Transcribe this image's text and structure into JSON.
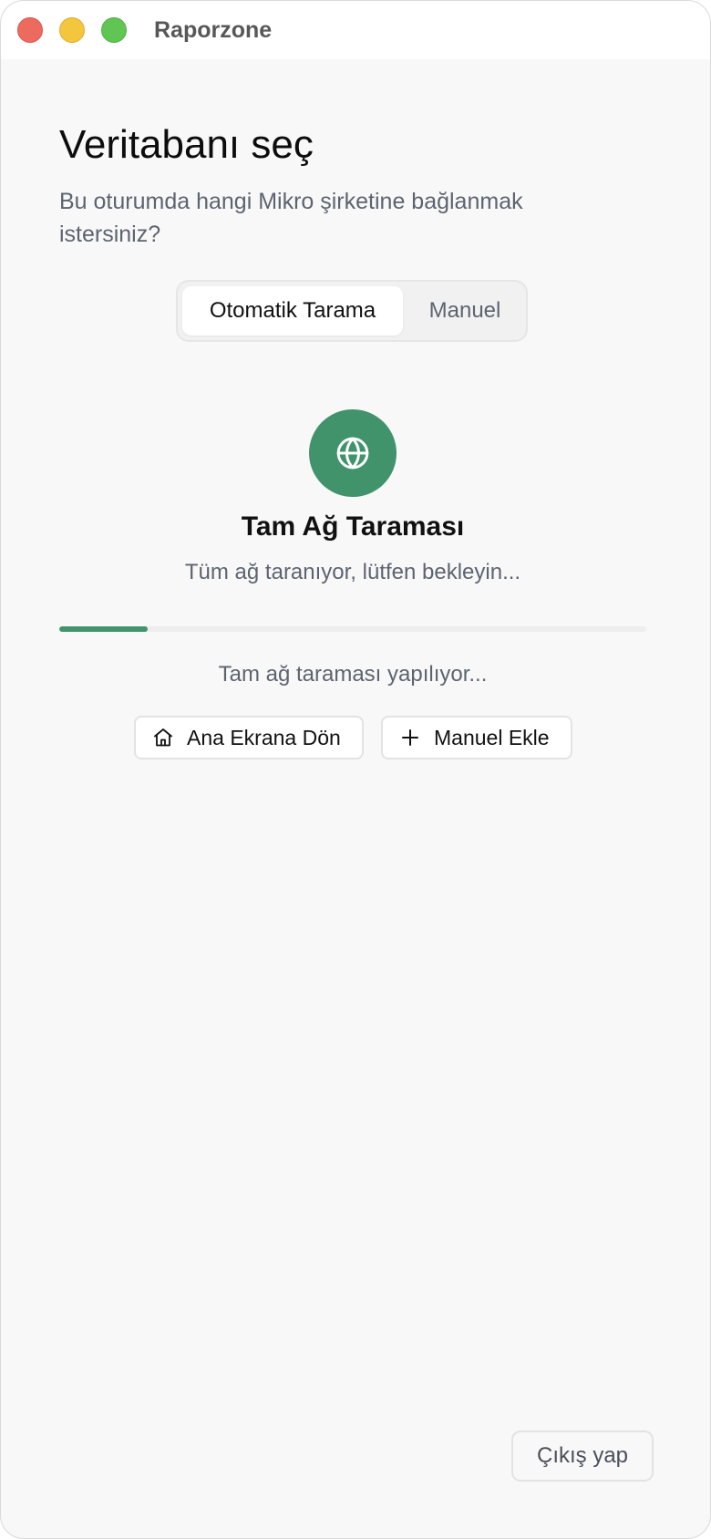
{
  "window": {
    "app_title": "Raporzone"
  },
  "header": {
    "title": "Veritabanı seç",
    "subtitle": "Bu oturumda hangi Mikro şirketine bağlanmak istersiniz?"
  },
  "tabs": [
    {
      "label": "Otomatik Tarama",
      "active": true
    },
    {
      "label": "Manuel",
      "active": false
    }
  ],
  "scan": {
    "icon": "globe-icon",
    "title": "Tam Ağ Taraması",
    "description": "Tüm ağ taranıyor, lütfen bekleyin...",
    "progress_fraction": 0.15,
    "status": "Tam ağ taraması yapılıyor..."
  },
  "actions": {
    "home_icon": "home-icon",
    "home_label": "Ana Ekrana Dön",
    "add_icon": "plus-icon",
    "add_label": "Manuel Ekle"
  },
  "footer": {
    "logout_label": "Çıkış yap"
  },
  "colors": {
    "accent": "#41936b",
    "close": "#ec6a5e",
    "minimize": "#f4c63d",
    "maximize": "#61c554"
  }
}
